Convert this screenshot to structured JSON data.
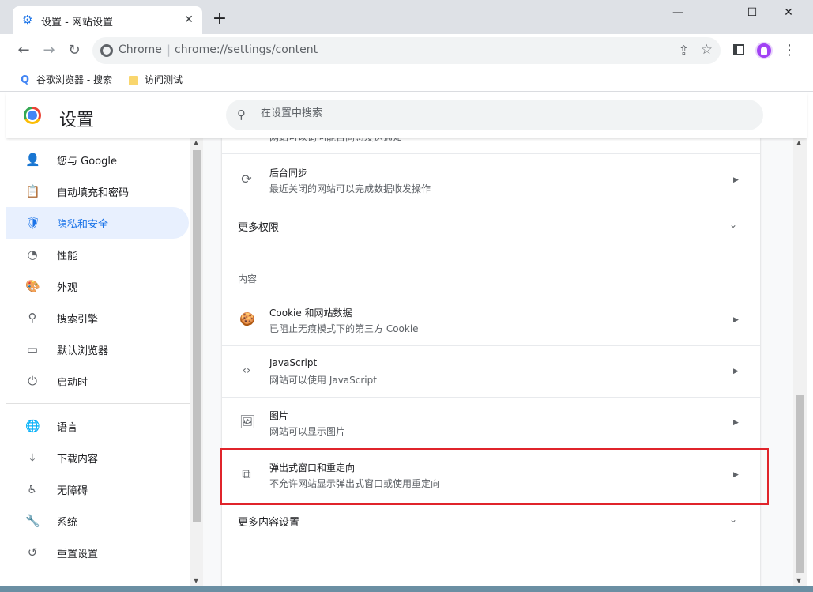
{
  "tab": {
    "title": "设置 - 网站设置",
    "close": "✕",
    "new_tab": "+"
  },
  "window_controls": {
    "minimize": "—",
    "maximize": "☐",
    "close": "✕"
  },
  "toolbar": {
    "back": "←",
    "forward": "→",
    "reload": "↻",
    "scheme": "Chrome",
    "separator": "|",
    "url": "chrome://settings/content",
    "share": "⇪",
    "star": "☆",
    "menu": "⋮"
  },
  "bookmarks": [
    {
      "label": "谷歌浏览器 - 搜索",
      "icon": "google-icon"
    },
    {
      "label": "访问测试",
      "icon": "folder-icon"
    }
  ],
  "header": {
    "title": "设置",
    "search_placeholder": "在设置中搜索",
    "search_glyph": "⚲"
  },
  "sidebar": {
    "items": [
      {
        "label": "您与 Google",
        "icon": "person-icon",
        "glyph": "👤"
      },
      {
        "label": "自动填充和密码",
        "icon": "clipboard-icon",
        "glyph": "📋"
      },
      {
        "label": "隐私和安全",
        "icon": "shield-icon",
        "glyph": "🛡",
        "active": true
      },
      {
        "label": "性能",
        "icon": "speedometer-icon",
        "glyph": "◔"
      },
      {
        "label": "外观",
        "icon": "palette-icon",
        "glyph": "🎨"
      },
      {
        "label": "搜索引擎",
        "icon": "search-icon",
        "glyph": "⚲"
      },
      {
        "label": "默认浏览器",
        "icon": "browser-icon",
        "glyph": "▭"
      },
      {
        "label": "启动时",
        "icon": "power-icon",
        "glyph": "⏻"
      },
      {
        "label": "语言",
        "icon": "globe-icon",
        "glyph": "🌐"
      },
      {
        "label": "下载内容",
        "icon": "download-icon",
        "glyph": "⤓"
      },
      {
        "label": "无障碍",
        "icon": "accessibility-icon",
        "glyph": "♿"
      },
      {
        "label": "系统",
        "icon": "wrench-icon",
        "glyph": "🔧"
      },
      {
        "label": "重置设置",
        "icon": "history-icon",
        "glyph": "↺"
      }
    ]
  },
  "content": {
    "partial_top_text": "网站可以询问能否向您发送通知",
    "background_sync": {
      "title": "后台同步",
      "subtitle": "最近关闭的网站可以完成数据收发操作",
      "icon": "sync-icon",
      "glyph": "⟳"
    },
    "more_permissions": "更多权限",
    "section_content": "内容",
    "rows": [
      {
        "title": "Cookie 和网站数据",
        "subtitle": "已阻止无痕模式下的第三方 Cookie",
        "icon": "cookie-icon",
        "glyph": "🍪"
      },
      {
        "title": "JavaScript",
        "subtitle": "网站可以使用 JavaScript",
        "icon": "code-icon",
        "glyph": "‹›"
      },
      {
        "title": "图片",
        "subtitle": "网站可以显示图片",
        "icon": "image-icon",
        "glyph": "🖼"
      },
      {
        "title": "弹出式窗口和重定向",
        "subtitle": "不允许网站显示弹出式窗口或使用重定向",
        "icon": "open-external-icon",
        "glyph": "⧉"
      }
    ],
    "more_content_settings": "更多内容设置",
    "arrow_glyph": "▶",
    "chevron_glyph": "⌄"
  },
  "colors": {
    "accent": "#1a73e8",
    "highlight_border": "#e0242b",
    "active_bg": "#e8f0fe"
  }
}
